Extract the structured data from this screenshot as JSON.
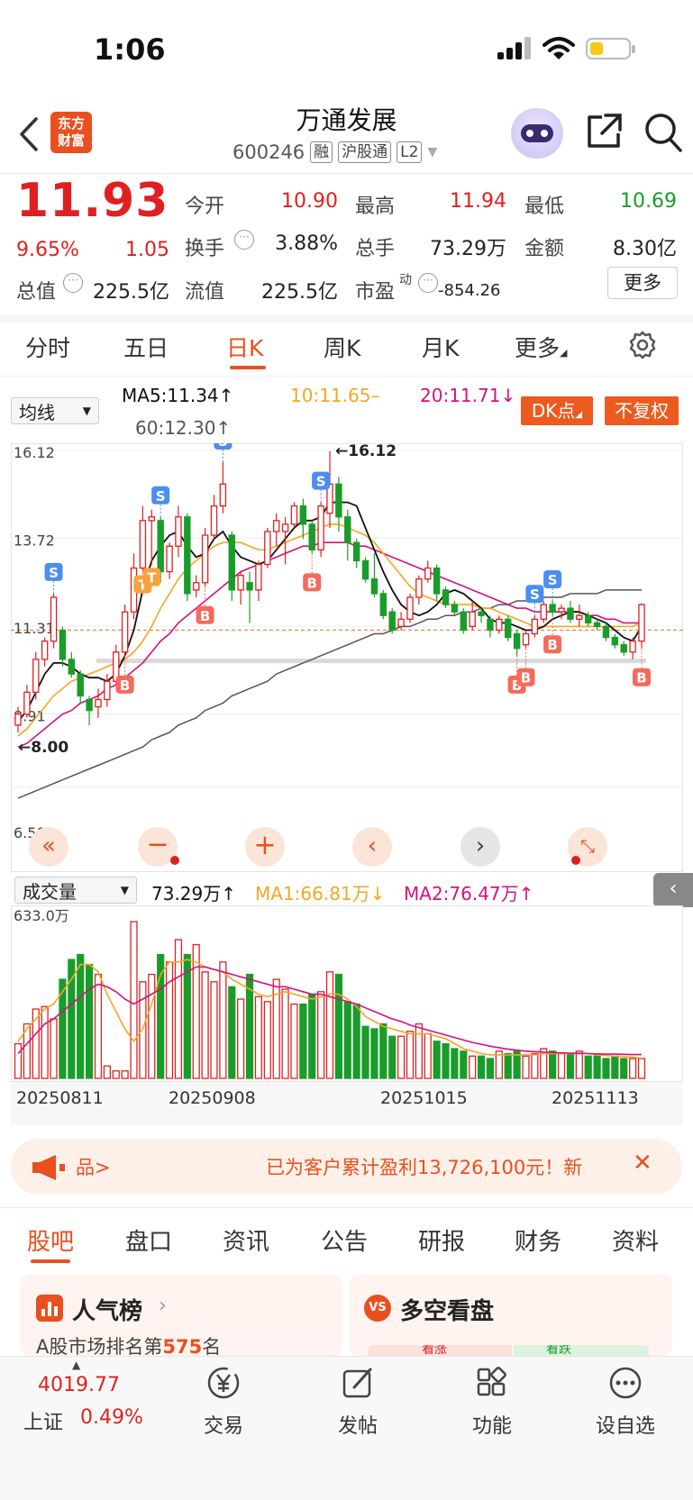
{
  "status": {
    "time": "1:06"
  },
  "header": {
    "logo_line1": "东方",
    "logo_line2": "财富",
    "title": "万通发展",
    "code": "600246",
    "tags": [
      "融",
      "沪股通",
      "L2"
    ]
  },
  "quote": {
    "price": "11.93",
    "change_pct": "9.65%",
    "change": "1.05",
    "open_label": "今开",
    "open": "10.90",
    "high_label": "最高",
    "high": "11.94",
    "low_label": "最低",
    "low": "10.69",
    "turnover_label": "换手",
    "turnover": "3.88%",
    "volume_label": "总手",
    "volume": "73.29万",
    "amount_label": "金额",
    "amount": "8.30亿",
    "total_cap_label": "总值",
    "total_cap": "225.5亿",
    "float_cap_label": "流值",
    "float_cap": "225.5亿",
    "pe_label": "市盈",
    "pe_sup": "动",
    "pe": "-854.26",
    "more_label": "更多"
  },
  "period_tabs": [
    {
      "label": "分时"
    },
    {
      "label": "五日"
    },
    {
      "label": "日K"
    },
    {
      "label": "周K"
    },
    {
      "label": "月K"
    },
    {
      "label": "更多"
    }
  ],
  "ma_row": {
    "selector": "均线",
    "ma5": "MA5:11.34↑",
    "ma10": "10:11.65–",
    "ma20": "20:11.71↓",
    "ma60": "60:12.30↑",
    "dk_btn": "DK点",
    "fq_btn": "不复权"
  },
  "colors": {
    "up": "#e02020",
    "down": "#1a9c2a",
    "ma5": "#111111",
    "ma10": "#f5a623",
    "ma20": "#d6107f",
    "ma60": "#555555",
    "accent": "#e8501f"
  },
  "chart_data": {
    "type": "candlestick",
    "y_axis_labels": [
      "16.12",
      "13.72",
      "11.31",
      "8.91",
      "6.50"
    ],
    "high_marker": "16.12",
    "low_marker": "8.00",
    "x_labels": [
      "20250811",
      "20250908",
      "20251015",
      "20251113"
    ],
    "candles": [
      [
        8.6,
        8.9,
        8.4,
        9.1
      ],
      [
        8.9,
        9.5,
        8.8,
        9.7
      ],
      [
        9.5,
        10.4,
        9.3,
        10.6
      ],
      [
        10.4,
        10.9,
        10.2,
        11.0
      ],
      [
        10.9,
        12.1,
        10.7,
        12.2
      ],
      [
        11.2,
        10.4,
        10.2,
        11.3
      ],
      [
        10.4,
        10.0,
        9.9,
        10.6
      ],
      [
        10.0,
        9.4,
        9.2,
        10.1
      ],
      [
        9.3,
        9.0,
        8.6,
        9.4
      ],
      [
        9.1,
        9.3,
        8.8,
        9.6
      ],
      [
        9.3,
        9.8,
        9.1,
        10.0
      ],
      [
        9.8,
        10.6,
        9.7,
        10.8
      ],
      [
        10.6,
        11.7,
        10.5,
        11.9
      ],
      [
        11.7,
        12.9,
        11.5,
        13.3
      ],
      [
        12.9,
        14.2,
        12.8,
        14.6
      ],
      [
        14.2,
        14.3,
        13.0,
        14.5
      ],
      [
        14.2,
        12.8,
        12.5,
        14.3
      ],
      [
        12.8,
        13.5,
        12.6,
        13.6
      ],
      [
        13.5,
        14.3,
        13.2,
        14.6
      ],
      [
        14.3,
        12.2,
        12.0,
        14.4
      ],
      [
        12.3,
        12.5,
        12.1,
        12.7
      ],
      [
        12.5,
        13.8,
        12.4,
        14.0
      ],
      [
        13.8,
        14.6,
        13.7,
        14.9
      ],
      [
        14.6,
        15.2,
        14.4,
        15.8
      ],
      [
        13.8,
        12.3,
        12.0,
        13.9
      ],
      [
        12.3,
        12.7,
        11.9,
        12.8
      ],
      [
        12.5,
        12.3,
        11.4,
        12.8
      ],
      [
        12.3,
        13.0,
        12.0,
        13.1
      ],
      [
        13.0,
        13.9,
        12.9,
        14.0
      ],
      [
        13.9,
        14.2,
        13.5,
        14.4
      ],
      [
        13.9,
        14.1,
        13.0,
        14.3
      ],
      [
        14.1,
        14.6,
        14.0,
        14.7
      ],
      [
        14.6,
        14.1,
        13.7,
        14.8
      ],
      [
        14.1,
        13.4,
        13.3,
        14.2
      ],
      [
        13.4,
        14.6,
        13.2,
        14.7
      ],
      [
        14.4,
        15.2,
        14.0,
        16.1
      ],
      [
        15.2,
        14.3,
        13.9,
        15.4
      ],
      [
        14.3,
        13.6,
        13.1,
        14.5
      ],
      [
        13.6,
        13.1,
        12.9,
        13.7
      ],
      [
        13.1,
        12.6,
        12.5,
        13.2
      ],
      [
        12.6,
        12.2,
        12.1,
        13.3
      ],
      [
        12.2,
        11.6,
        11.5,
        12.3
      ],
      [
        11.7,
        11.2,
        11.1,
        11.8
      ],
      [
        11.3,
        11.5,
        11.2,
        11.7
      ],
      [
        11.5,
        12.1,
        11.4,
        12.2
      ],
      [
        12.1,
        12.6,
        11.9,
        12.7
      ],
      [
        12.6,
        12.9,
        12.5,
        13.1
      ],
      [
        12.9,
        12.2,
        12.0,
        13.0
      ],
      [
        12.3,
        11.9,
        11.8,
        12.4
      ],
      [
        11.9,
        11.7,
        11.6,
        12.0
      ],
      [
        11.7,
        11.2,
        11.1,
        11.8
      ],
      [
        11.3,
        11.7,
        11.2,
        12.0
      ],
      [
        11.7,
        11.6,
        11.4,
        11.8
      ],
      [
        11.5,
        11.2,
        11.0,
        11.6
      ],
      [
        11.2,
        11.5,
        11.1,
        11.6
      ],
      [
        11.5,
        11.0,
        10.9,
        11.6
      ],
      [
        11.1,
        10.7,
        10.5,
        11.2
      ],
      [
        10.8,
        11.1,
        10.7,
        11.2
      ],
      [
        11.1,
        11.5,
        11.0,
        11.6
      ],
      [
        11.5,
        11.9,
        11.4,
        12.0
      ],
      [
        11.9,
        11.7,
        11.6,
        12.0
      ],
      [
        11.7,
        11.8,
        11.5,
        11.9
      ],
      [
        11.8,
        11.5,
        11.4,
        12.0
      ],
      [
        11.5,
        11.6,
        11.3,
        11.9
      ],
      [
        11.6,
        11.4,
        11.3,
        11.7
      ],
      [
        11.4,
        11.3,
        11.2,
        11.5
      ],
      [
        11.3,
        11.0,
        10.9,
        11.4
      ],
      [
        11.0,
        10.8,
        10.7,
        11.1
      ],
      [
        10.8,
        10.6,
        10.5,
        10.9
      ],
      [
        10.6,
        10.9,
        10.4,
        11.0
      ],
      [
        10.9,
        11.9,
        10.7,
        11.94
      ]
    ],
    "ma5": [
      8.7,
      9.0,
      9.5,
      10.0,
      10.3,
      10.3,
      10.2,
      10.0,
      9.9,
      9.9,
      9.8,
      10.0,
      10.5,
      11.2,
      12.3,
      13.1,
      13.5,
      13.8,
      13.9,
      13.5,
      13.2,
      13.3,
      13.7,
      13.9,
      13.5,
      13.2,
      13.1,
      13.0,
      13.1,
      13.4,
      13.7,
      14.0,
      14.2,
      14.2,
      14.3,
      14.7,
      14.7,
      14.7,
      14.6,
      14.0,
      13.4,
      12.8,
      12.3,
      11.9,
      11.7,
      11.6,
      11.7,
      11.9,
      12.2,
      12.3,
      12.2,
      12.0,
      11.8,
      11.5,
      11.4,
      11.4,
      11.3,
      11.2,
      11.2,
      11.3,
      11.5,
      11.6,
      11.7,
      11.7,
      11.6,
      11.5,
      11.4,
      11.2,
      11.0,
      10.9,
      11.3
    ],
    "ma10": [
      8.3,
      8.5,
      8.8,
      9.1,
      9.4,
      9.6,
      9.8,
      9.9,
      10.0,
      10.1,
      10.2,
      10.3,
      10.4,
      10.6,
      10.9,
      11.3,
      11.8,
      12.2,
      12.6,
      12.9,
      13.1,
      13.3,
      13.5,
      13.6,
      13.6,
      13.6,
      13.5,
      13.4,
      13.4,
      13.5,
      13.6,
      13.7,
      13.8,
      13.9,
      14.0,
      14.1,
      14.1,
      14.0,
      13.9,
      13.8,
      13.6,
      13.3,
      13.0,
      12.7,
      12.4,
      12.2,
      12.1,
      12.0,
      11.9,
      11.9,
      11.9,
      11.9,
      11.8,
      11.8,
      11.7,
      11.6,
      11.5,
      11.4,
      11.3,
      11.3,
      11.3,
      11.3,
      11.3,
      11.3,
      11.3,
      11.3,
      11.3,
      11.3,
      11.3,
      11.3,
      11.4
    ],
    "ma20": [
      8.0,
      8.1,
      8.3,
      8.5,
      8.7,
      8.9,
      9.0,
      9.2,
      9.3,
      9.4,
      9.6,
      9.7,
      9.9,
      10.1,
      10.3,
      10.6,
      10.9,
      11.1,
      11.4,
      11.6,
      11.8,
      12.0,
      12.2,
      12.4,
      12.6,
      12.8,
      12.9,
      13.0,
      13.1,
      13.2,
      13.3,
      13.4,
      13.5,
      13.5,
      13.6,
      13.6,
      13.6,
      13.6,
      13.5,
      13.5,
      13.4,
      13.3,
      13.2,
      13.1,
      13.0,
      12.9,
      12.8,
      12.7,
      12.6,
      12.5,
      12.4,
      12.3,
      12.2,
      12.1,
      12.0,
      11.9,
      11.8,
      11.8,
      11.7,
      11.7,
      11.7,
      11.7,
      11.7,
      11.7,
      11.6,
      11.6,
      11.5,
      11.5,
      11.4,
      11.4,
      11.4
    ],
    "ma60": [
      6.6,
      6.7,
      6.8,
      6.9,
      7.0,
      7.1,
      7.2,
      7.3,
      7.4,
      7.5,
      7.6,
      7.7,
      7.8,
      7.9,
      8.0,
      8.2,
      8.3,
      8.4,
      8.6,
      8.7,
      8.8,
      9.0,
      9.1,
      9.2,
      9.4,
      9.5,
      9.6,
      9.7,
      9.8,
      10.0,
      10.1,
      10.2,
      10.3,
      10.4,
      10.5,
      10.6,
      10.7,
      10.8,
      10.9,
      11.0,
      11.1,
      11.1,
      11.2,
      11.3,
      11.3,
      11.4,
      11.5,
      11.5,
      11.6,
      11.6,
      11.7,
      11.7,
      11.8,
      11.8,
      11.9,
      11.9,
      12.0,
      12.0,
      12.0,
      12.1,
      12.1,
      12.1,
      12.2,
      12.2,
      12.2,
      12.2,
      12.3,
      12.3,
      12.3,
      12.3,
      12.3
    ],
    "signals": [
      {
        "i": 4,
        "label": "S",
        "kind": "sell"
      },
      {
        "i": 12,
        "label": "B",
        "kind": "buy"
      },
      {
        "i": 14,
        "label": "T",
        "kind": "t"
      },
      {
        "i": 15,
        "label": "T",
        "kind": "t"
      },
      {
        "i": 16,
        "label": "S",
        "kind": "sell"
      },
      {
        "i": 21,
        "label": "B",
        "kind": "buy"
      },
      {
        "i": 23,
        "label": "S",
        "kind": "sell"
      },
      {
        "i": 33,
        "label": "B",
        "kind": "buy"
      },
      {
        "i": 34,
        "label": "S",
        "kind": "sell"
      },
      {
        "i": 56,
        "label": "B",
        "kind": "buy"
      },
      {
        "i": 57,
        "label": "B",
        "kind": "buy"
      },
      {
        "i": 58,
        "label": "S",
        "kind": "sell"
      },
      {
        "i": 60,
        "label": "S",
        "kind": "sell"
      },
      {
        "i": 60,
        "label": "B",
        "kind": "buy"
      },
      {
        "i": 70,
        "label": "B",
        "kind": "buy"
      }
    ],
    "volume_title": "成交量",
    "volume_value": "73.29万↑",
    "volume_ma1": "MA1:66.81万↓",
    "volume_ma2": "MA2:76.47万↑",
    "volume_max": "633.0万",
    "volumes": [
      140,
      220,
      280,
      290,
      240,
      400,
      480,
      500,
      460,
      420,
      50,
      30,
      30,
      633,
      390,
      420,
      500,
      470,
      560,
      500,
      540,
      430,
      390,
      470,
      370,
      320,
      420,
      330,
      310,
      400,
      360,
      300,
      300,
      340,
      350,
      430,
      420,
      310,
      300,
      210,
      200,
      220,
      170,
      170,
      190,
      220,
      180,
      150,
      140,
      120,
      110,
      90,
      90,
      80,
      110,
      100,
      110,
      90,
      100,
      120,
      110,
      100,
      100,
      110,
      90,
      90,
      80,
      90,
      80,
      80,
      80
    ],
    "volume_ma1_series": [
      150,
      200,
      240,
      280,
      300,
      350,
      400,
      460,
      460,
      430,
      340,
      270,
      200,
      150,
      200,
      300,
      420,
      470,
      470,
      480,
      470,
      450,
      440,
      430,
      400,
      380,
      360,
      340,
      330,
      340,
      350,
      340,
      330,
      320,
      330,
      340,
      340,
      320,
      290,
      250,
      230,
      210,
      200,
      190,
      180,
      180,
      180,
      170,
      160,
      140,
      120,
      110,
      100,
      95,
      95,
      95,
      95,
      95,
      95,
      100,
      100,
      100,
      100,
      100,
      100,
      95,
      92,
      90,
      88,
      85,
      82
    ],
    "volume_ma2_series": [
      100,
      140,
      180,
      220,
      240,
      270,
      300,
      330,
      360,
      380,
      370,
      350,
      320,
      300,
      320,
      340,
      360,
      390,
      410,
      430,
      450,
      450,
      440,
      430,
      420,
      410,
      400,
      390,
      380,
      370,
      370,
      360,
      350,
      340,
      340,
      330,
      320,
      310,
      300,
      285,
      270,
      255,
      240,
      230,
      215,
      205,
      195,
      185,
      175,
      165,
      155,
      145,
      138,
      130,
      124,
      118,
      114,
      110,
      108,
      106,
      104,
      103,
      102,
      101,
      100,
      99,
      98,
      98,
      97,
      96,
      96
    ]
  },
  "ad": {
    "left_text": "品>",
    "text": "已为客户累计盈利13,726,100元！新"
  },
  "section_tabs": [
    {
      "label": "股吧"
    },
    {
      "label": "盘口"
    },
    {
      "label": "资讯"
    },
    {
      "label": "公告"
    },
    {
      "label": "研报"
    },
    {
      "label": "财务"
    },
    {
      "label": "资料"
    }
  ],
  "cards": {
    "popular_title": "人气榜",
    "popular_sub_prefix": "A股市场排名第",
    "popular_rank": "575",
    "popular_sub_suffix": "名",
    "vs_title": "多空看盘",
    "vs_up": "看涨",
    "vs_down": "看跌"
  },
  "bottom_nav": {
    "index_value": "4019.77",
    "index_name": "上证",
    "index_change": "0.49%",
    "trade": "交易",
    "post": "发帖",
    "func": "功能",
    "watch": "设自选"
  }
}
